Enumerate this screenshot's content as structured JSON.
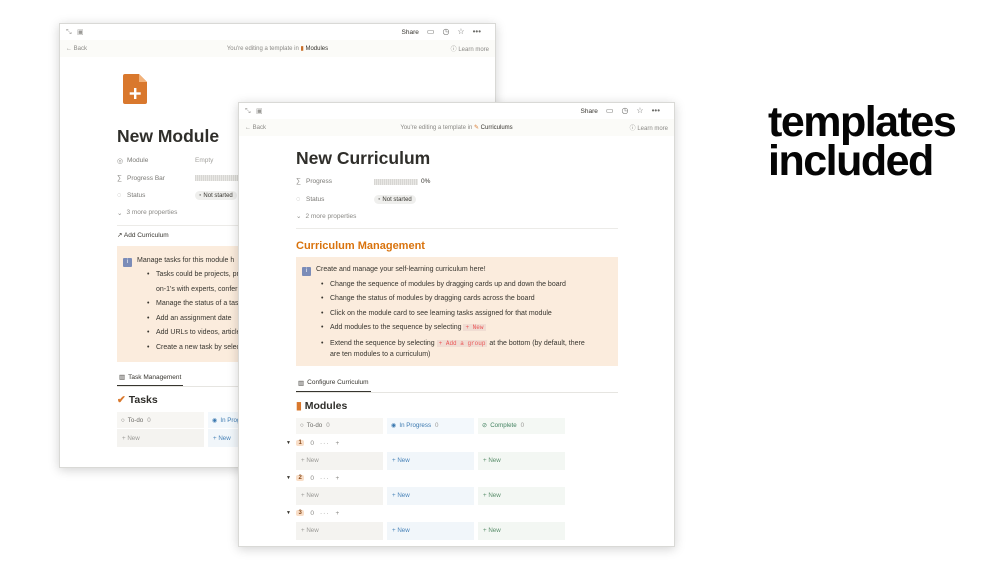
{
  "tagline": {
    "line1": "templates",
    "line2": "included"
  },
  "window_common": {
    "share": "Share",
    "back": "Back",
    "editing_prefix": "You're editing a template in",
    "learn_more": "Learn more",
    "new_label": "New"
  },
  "module_page": {
    "breadcrumb": "Modules",
    "title": "New Module",
    "properties": [
      {
        "icon": "target-icon",
        "name": "Module",
        "value": "Empty"
      },
      {
        "icon": "sigma-icon",
        "name": "Progress Bar",
        "value": ""
      },
      {
        "icon": "status-icon",
        "name": "Status",
        "value": "Not started"
      }
    ],
    "more_properties": "3 more properties",
    "add_relation": "Add Curriculum",
    "callout": {
      "intro": "Manage tasks for this module h",
      "items": [
        "Tasks could be projects, pr",
        "on-1's with experts, confer",
        "Manage the status of a task",
        "Add an assignment date",
        "Add URLs to videos, article",
        "Create a new task by selec"
      ]
    },
    "tab": "Task Management",
    "board_title": "Tasks",
    "columns": [
      {
        "label": "To-do",
        "count": "0"
      },
      {
        "label": "In Prog",
        "count": ""
      }
    ]
  },
  "curriculum_page": {
    "breadcrumb": "Curriculums",
    "title": "New Curriculum",
    "properties": [
      {
        "icon": "sigma-icon",
        "name": "Progress",
        "value": "0%"
      },
      {
        "icon": "status-icon",
        "name": "Status",
        "value": "Not started"
      }
    ],
    "more_properties": "2 more properties",
    "section_heading": "Curriculum Management",
    "callout": {
      "intro": "Create and manage your self-learning curriculum here!",
      "items": [
        "Change the sequence of modules by dragging cards up and down the board",
        "Change the status of modules by dragging cards across the board",
        "Click on the module card to see learning tasks assigned for that module"
      ],
      "item4_prefix": "Add modules to the sequence by selecting",
      "item4_code": "+ New",
      "item5_prefix": "Extend the sequence by selecting",
      "item5_code": "+ Add a group",
      "item5_suffix": "at the bottom (by default, there",
      "item5_line2": "are ten modules to a curriculum)"
    },
    "tab": "Configure Curriculum",
    "board_title": "Modules",
    "columns": [
      {
        "label": "To-do",
        "count": "0"
      },
      {
        "label": "In Progress",
        "count": "0"
      },
      {
        "label": "Complete",
        "count": "0"
      }
    ],
    "groups": [
      {
        "num": "1",
        "count": "0"
      },
      {
        "num": "2",
        "count": "0"
      },
      {
        "num": "3",
        "count": "0"
      }
    ]
  }
}
